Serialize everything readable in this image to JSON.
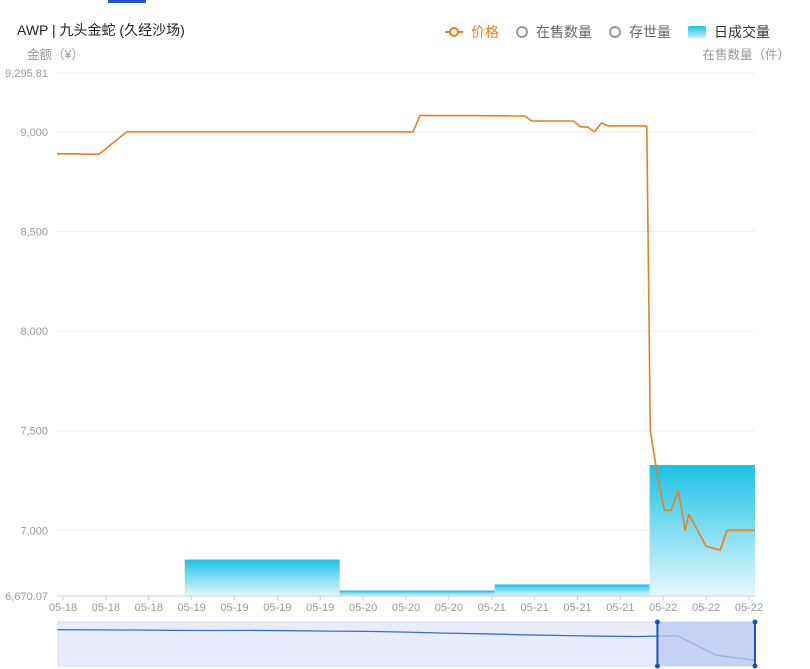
{
  "title": "AWP | 九头金蛇 (久经沙场)",
  "left_unit": "金额（¥）",
  "right_unit": "在售数量（件）",
  "legend": [
    {
      "label": "价格",
      "icon": "line-circle-icon",
      "active": true
    },
    {
      "label": "在售数量",
      "icon": "circle-icon",
      "active": false
    },
    {
      "label": "存世量",
      "icon": "circle-icon",
      "active": false
    },
    {
      "label": "日成交量",
      "icon": "gradient-rect-icon",
      "active": true
    }
  ],
  "colors": {
    "price_line": "#e8801e",
    "volume_top": "#1cc2e6",
    "volume_bottom": "#e6f8fd",
    "axis": "#999999",
    "grid": "#f0f0f0",
    "slider_line": "#3a6bd0",
    "slider_window": "#b8caf2",
    "slider_bg": "#e9edfb"
  },
  "chart_data": {
    "type": "line",
    "y_ticks": [
      "9,295.81",
      "9,000",
      "8,500",
      "8,000",
      "7,500",
      "7,000",
      "6,670.07"
    ],
    "ylim": [
      6670.07,
      9295.81
    ],
    "x_ticks": [
      "05-18",
      "05-18",
      "05-18",
      "05-19",
      "05-19",
      "05-19",
      "05-19",
      "05-20",
      "05-20",
      "05-20",
      "05-21",
      "05-21",
      "05-21",
      "05-21",
      "05-22",
      "05-22",
      "05-22"
    ],
    "grid": true,
    "series": [
      {
        "name": "价格",
        "type": "line",
        "x": [
          0,
          0.03,
          0.04,
          0.05,
          0.06,
          0.1,
          0.2,
          0.3,
          0.4,
          0.5,
          0.51,
          0.52,
          0.6,
          0.65,
          0.67,
          0.68,
          0.74,
          0.75,
          0.76,
          0.77,
          0.78,
          0.79,
          0.82,
          0.83,
          0.84,
          0.845,
          0.85,
          0.86,
          0.87,
          0.88,
          0.89,
          0.9,
          0.905,
          0.91,
          0.93,
          0.95,
          0.96,
          0.97,
          0.98,
          0.99,
          1.0
        ],
        "values": [
          8890,
          8890,
          8888,
          8888,
          8888,
          9000,
          9000,
          9000,
          9000,
          9000,
          9000,
          9082,
          9082,
          9080,
          9080,
          9055,
          9055,
          9025,
          9025,
          9000,
          9045,
          9030,
          9030,
          9030,
          9030,
          9028,
          7500,
          7280,
          7100,
          7100,
          7200,
          7000,
          7080,
          7050,
          6920,
          6900,
          7000,
          7000,
          7000,
          7000,
          7000
        ]
      },
      {
        "name": "日成交量",
        "type": "bar",
        "segments": [
          {
            "x_start": 0.183,
            "x_end": 0.405,
            "value": 6853
          },
          {
            "x_start": 0.405,
            "x_end": 0.627,
            "value": 6697
          },
          {
            "x_start": 0.627,
            "x_end": 0.849,
            "value": 6728
          },
          {
            "x_start": 0.849,
            "x_end": 1.0,
            "value": 7327
          }
        ]
      }
    ],
    "slider": {
      "window_start": 0.86,
      "window_end": 1.0,
      "series": [
        0.95,
        0.945,
        0.94,
        0.93,
        0.925,
        0.93,
        0.92,
        0.91,
        0.9,
        0.88,
        0.85,
        0.83,
        0.8,
        0.78,
        0.76,
        0.75,
        0.77,
        0.2,
        0.05
      ]
    }
  }
}
